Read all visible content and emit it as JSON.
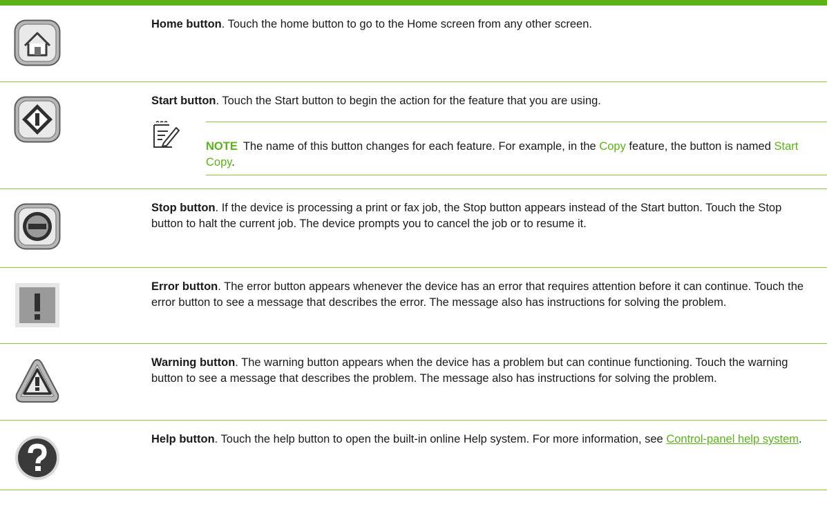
{
  "rows": [
    {
      "icon": "home-icon",
      "title": "Home button",
      "text": ". Touch the home button to go to the Home screen from any other screen."
    },
    {
      "icon": "start-icon",
      "title": "Start button",
      "text": ". Touch the Start button to begin the action for the feature that you are using.",
      "note": {
        "icon": "note-pad-icon",
        "label": "NOTE",
        "text_1": "The name of this button changes for each feature. For example, in the ",
        "term_1": "Copy",
        "text_2": " feature, the button is named ",
        "term_2": "Start Copy",
        "text_3": "."
      }
    },
    {
      "icon": "stop-icon",
      "title": "Stop button",
      "text": ". If the device is processing a print or fax job, the Stop button appears instead of the Start button. Touch the Stop button to halt the current job. The device prompts you to cancel the job or to resume it."
    },
    {
      "icon": "error-icon",
      "title": "Error button",
      "text": ". The error button appears whenever the device has an error that requires attention before it can continue. Touch the error button to see a message that describes the error. The message also has instructions for solving the problem."
    },
    {
      "icon": "warning-icon",
      "title": "Warning button",
      "text": ". The warning button appears when the device has a problem but can continue functioning. Touch the warning button to see a message that describes the problem. The message also has instructions for solving the problem."
    },
    {
      "icon": "help-icon",
      "title": "Help button",
      "text": ". Touch the help button to open the built-in online Help system. For more information, see ",
      "link": "Control-panel help system",
      "text_after": "."
    }
  ],
  "colors": {
    "accent": "#5bb318",
    "rule": "#8cc63f",
    "icon_gray": "#9a9a9a",
    "icon_dark": "#3a3a3a"
  }
}
